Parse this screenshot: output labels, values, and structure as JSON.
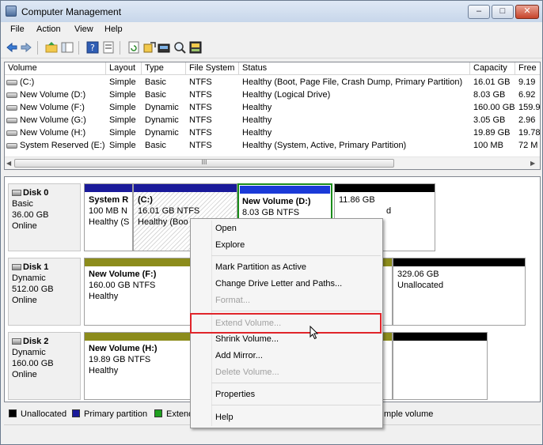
{
  "window": {
    "title": "Computer Management",
    "controls": {
      "minimize": "–",
      "maximize": "□",
      "close": "✕"
    }
  },
  "menu": [
    "File",
    "Action",
    "View",
    "Help"
  ],
  "toolbar_icons": [
    "back-icon",
    "forward-icon",
    "up-folder-icon",
    "show-hide-console-tree-icon",
    "help-icon",
    "properties-icon",
    "refresh-icon",
    "export-icon",
    "connect-icon",
    "rescan-icon",
    "disk-info-icon"
  ],
  "volume_list": {
    "columns": [
      "Volume",
      "Layout",
      "Type",
      "File System",
      "Status",
      "Capacity",
      "Free"
    ],
    "rows": [
      [
        "(C:)",
        "Simple",
        "Basic",
        "NTFS",
        "Healthy (Boot, Page File, Crash Dump, Primary Partition)",
        "16.01 GB",
        "9.19"
      ],
      [
        "New Volume (D:)",
        "Simple",
        "Basic",
        "NTFS",
        "Healthy (Logical Drive)",
        "8.03 GB",
        "6.92"
      ],
      [
        "New Volume (F:)",
        "Simple",
        "Dynamic",
        "NTFS",
        "Healthy",
        "160.00 GB",
        "159.9"
      ],
      [
        "New Volume (G:)",
        "Simple",
        "Dynamic",
        "NTFS",
        "Healthy",
        "3.05 GB",
        "2.96"
      ],
      [
        "New Volume (H:)",
        "Simple",
        "Dynamic",
        "NTFS",
        "Healthy",
        "19.89 GB",
        "19.78"
      ],
      [
        "System Reserved (E:)",
        "Simple",
        "Basic",
        "NTFS",
        "Healthy (System, Active, Primary Partition)",
        "100 MB",
        "72 M"
      ]
    ],
    "scroll_thumb": "III"
  },
  "disks": [
    {
      "name": "Disk 0",
      "type": "Basic",
      "size": "36.00 GB",
      "status": "Online",
      "partitions": [
        {
          "title": "System R",
          "size": "100 MB N",
          "status": "Healthy (S"
        },
        {
          "title": "(C:)",
          "size": "16.01 GB NTFS",
          "status": "Healthy (Boo"
        },
        {
          "title": "New Volume  (D:)",
          "size": "8.03 GB NTFS",
          "status": ""
        },
        {
          "title": "",
          "size": "11.86 GB",
          "status": "d"
        }
      ]
    },
    {
      "name": "Disk 1",
      "type": "Dynamic",
      "size": "512.00 GB",
      "status": "Online",
      "partitions": [
        {
          "title": "New Volume  (F:)",
          "size": "160.00 GB NTFS",
          "status": "Healthy"
        },
        {
          "title": "",
          "size": "329.06 GB",
          "status": "Unallocated"
        }
      ]
    },
    {
      "name": "Disk 2",
      "type": "Dynamic",
      "size": "160.00 GB",
      "status": "Online",
      "partitions": [
        {
          "title": "New Volume  (H:)",
          "size": "19.89 GB NTFS",
          "status": "Healthy"
        }
      ]
    }
  ],
  "legend": [
    {
      "label": "Unallocated",
      "color": "#000000"
    },
    {
      "label": "Primary partition",
      "color": "#1a1a9a"
    },
    {
      "label": "Extend",
      "color": "#1ea01e"
    },
    {
      "label": "mple volume",
      "color": "#8c8c1c"
    }
  ],
  "context_menu": {
    "items": [
      {
        "label": "Open",
        "enabled": true
      },
      {
        "label": "Explore",
        "enabled": true
      },
      {
        "label": "Mark Partition as Active",
        "enabled": true
      },
      {
        "label": "Change Drive Letter and Paths...",
        "enabled": true
      },
      {
        "label": "Format...",
        "enabled": false
      },
      {
        "label": "Extend Volume...",
        "enabled": false
      },
      {
        "label": "Shrink Volume...",
        "enabled": true
      },
      {
        "label": "Add Mirror...",
        "enabled": true
      },
      {
        "label": "Delete Volume...",
        "enabled": false
      },
      {
        "label": "Properties",
        "enabled": true
      },
      {
        "label": "Help",
        "enabled": true
      }
    ]
  },
  "colors": {
    "primary_bar": "#1a1a9a",
    "logical_bar": "#1a3ad8",
    "simple_bar": "#8c8c1c",
    "unallocated_bar": "#000000",
    "selection_outline": "#1a8d1a",
    "highlight_box": "#e0242a"
  }
}
